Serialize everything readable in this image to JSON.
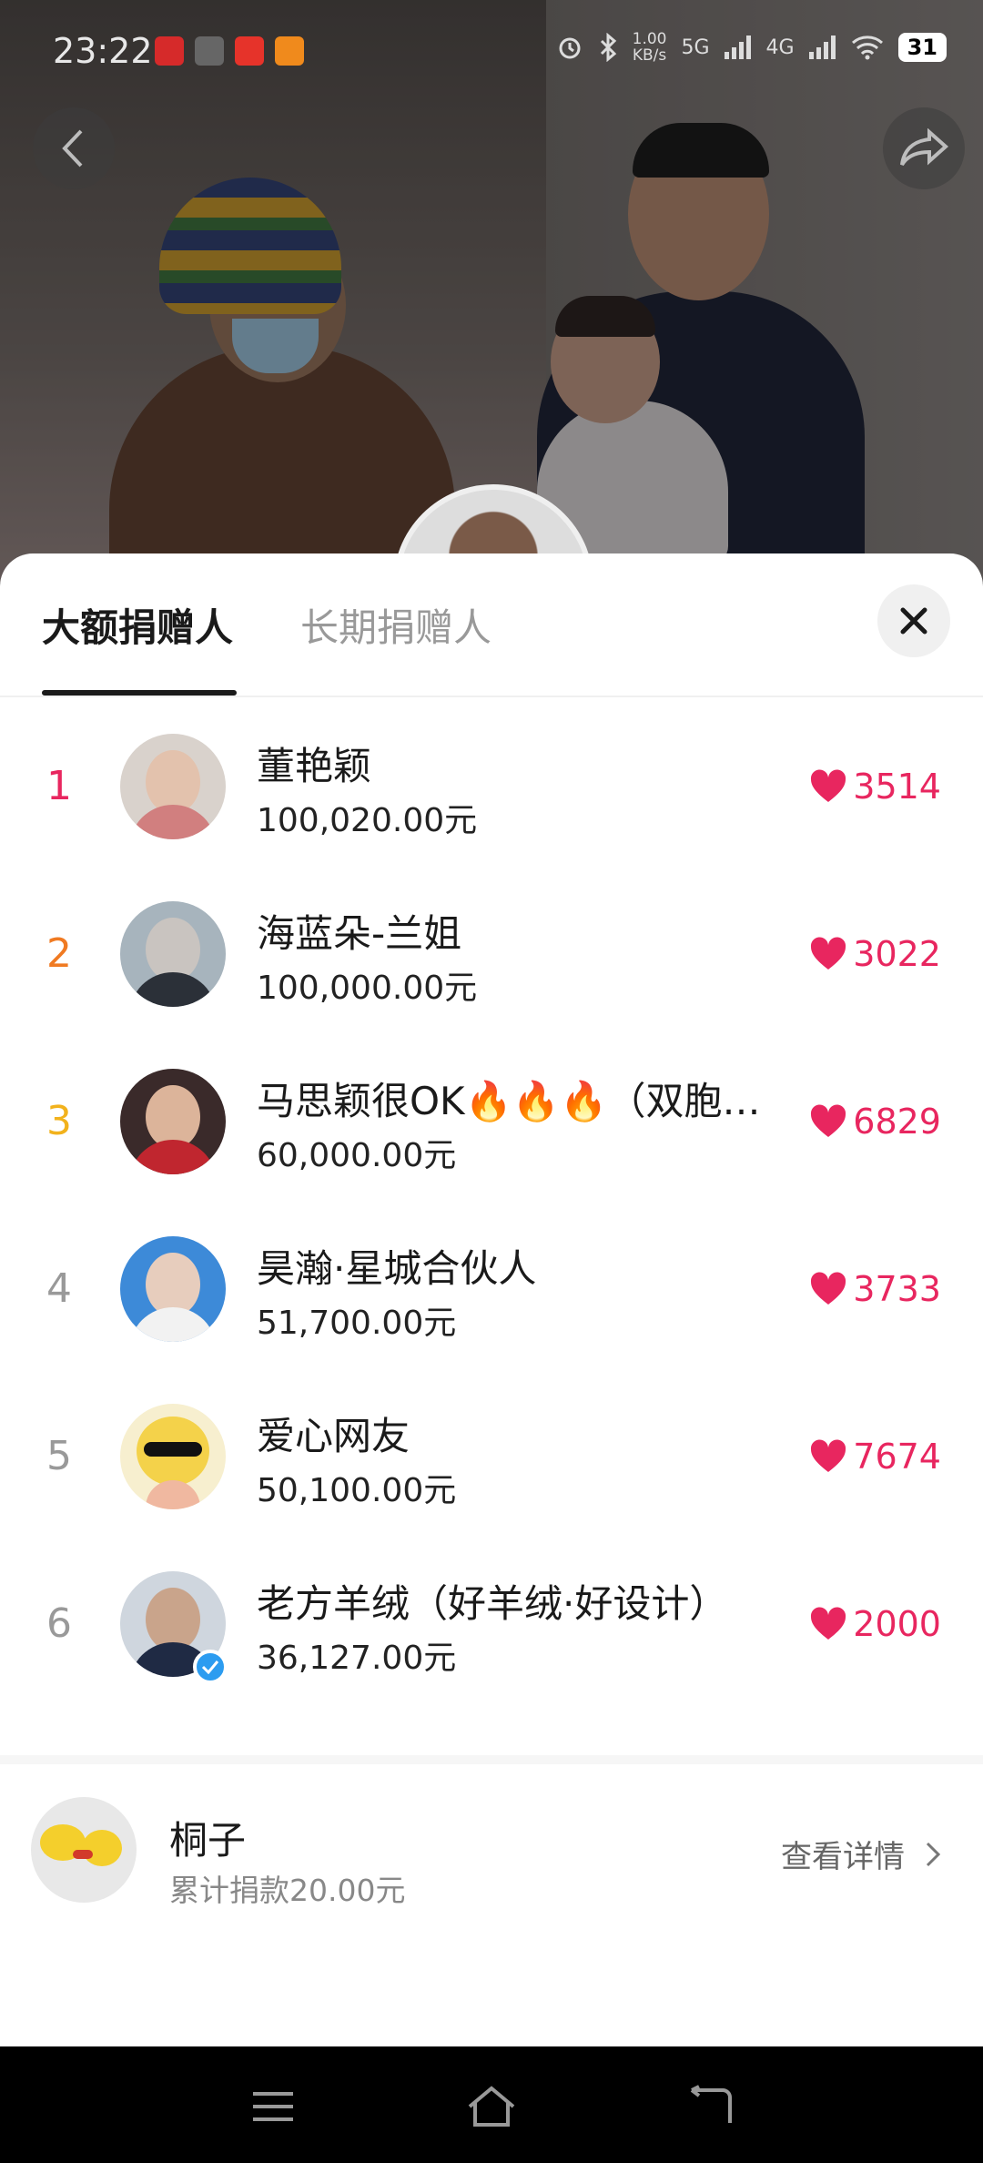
{
  "status_bar": {
    "time": "23:22",
    "speed_value": "1.00",
    "speed_unit": "KB/s",
    "net_5g": "5G",
    "net_4g": "4G",
    "battery": "31"
  },
  "tabs": [
    {
      "label": "大额捐赠人",
      "active": true
    },
    {
      "label": "长期捐赠人",
      "active": false
    }
  ],
  "donors": [
    {
      "rank": "1",
      "name": "董艳颖",
      "amount": "100,020.00元",
      "likes": "3514",
      "rank_color": "#e8265f",
      "verified": false
    },
    {
      "rank": "2",
      "name": "海蓝朵-兰姐",
      "amount": "100,000.00元",
      "likes": "3022",
      "rank_color": "#f07a22",
      "verified": false
    },
    {
      "rank": "3",
      "name": "马思颖很OK🔥🔥🔥（双胞…",
      "amount": "60,000.00元",
      "likes": "6829",
      "rank_color": "#f2b21c",
      "verified": false
    },
    {
      "rank": "4",
      "name": "昊瀚·星城合伙人",
      "amount": "51,700.00元",
      "likes": "3733",
      "rank_color": "#999999",
      "verified": false
    },
    {
      "rank": "5",
      "name": "爱心网友",
      "amount": "50,100.00元",
      "likes": "7674",
      "rank_color": "#999999",
      "verified": false
    },
    {
      "rank": "6",
      "name": "老方羊绒（好羊绒·好设计）",
      "amount": "36,127.00元",
      "likes": "2000",
      "rank_color": "#999999",
      "verified": true
    }
  ],
  "me": {
    "name": "桐子",
    "total": "累计捐款20.00元",
    "detail_label": "查看详情"
  },
  "icons": {
    "back": "chevron-left-icon",
    "share": "share-arrow-icon",
    "close": "close-icon",
    "like": "heart-icon",
    "detail": "chevron-right-icon"
  },
  "colors": {
    "accent": "#e8265f",
    "rank1": "#e8265f",
    "rank2": "#f07a22",
    "rank3": "#f2b21c",
    "rank_other": "#999999"
  }
}
